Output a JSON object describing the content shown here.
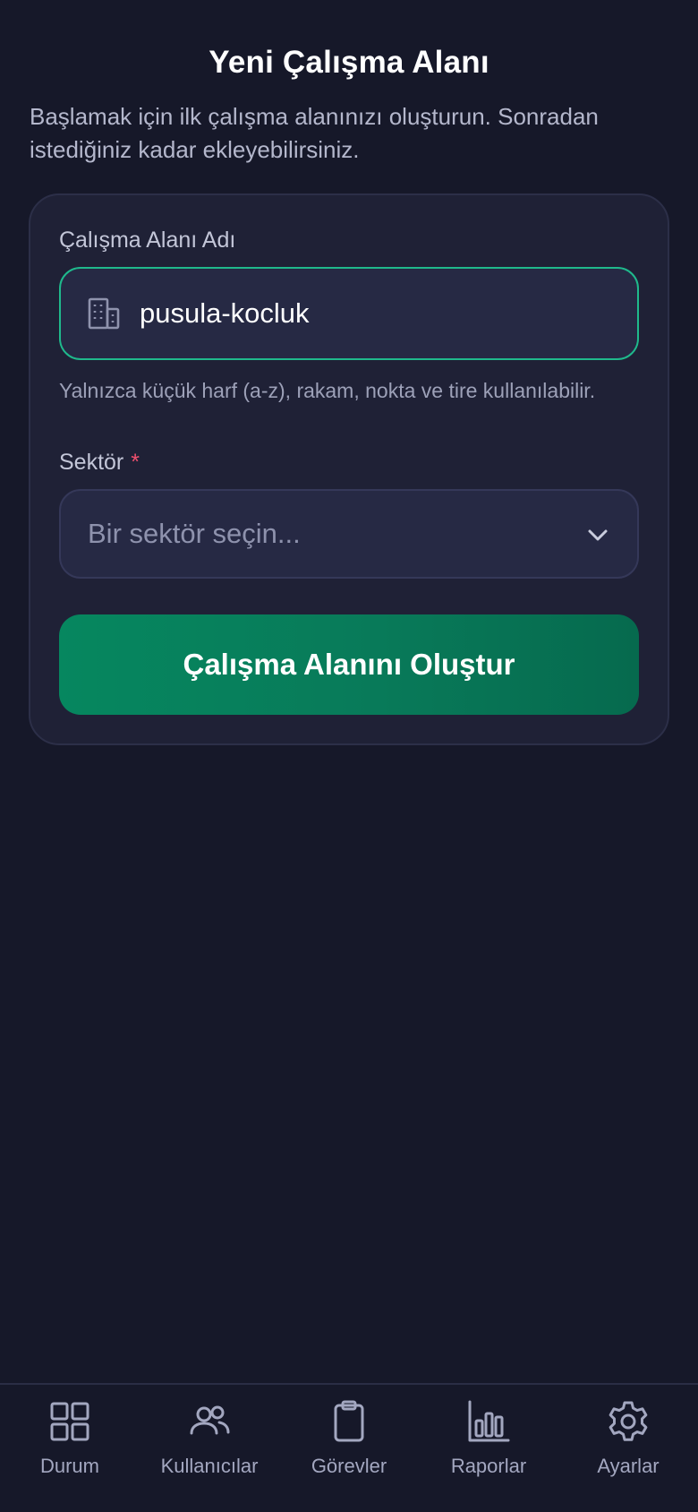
{
  "header": {
    "title": "Yeni Çalışma Alanı",
    "subtitle": "Başlamak için ilk çalışma alanınızı oluşturun. Sonradan istediğiniz kadar ekleyebilirsiniz."
  },
  "form": {
    "workspace_label": "Çalışma Alanı Adı",
    "workspace_value": "pusula-kocluk",
    "workspace_icon": "building-icon",
    "workspace_hint": "Yalnızca küçük harf (a-z), rakam, nokta ve tire kullanılabilir.",
    "sector_label": "Sektör",
    "sector_required_mark": "*",
    "sector_placeholder": "Bir sektör seçin...",
    "submit_label": "Çalışma Alanını Oluştur"
  },
  "tabbar": {
    "items": [
      {
        "label": "Durum",
        "icon": "grid-icon"
      },
      {
        "label": "Kullanıcılar",
        "icon": "users-icon"
      },
      {
        "label": "Görevler",
        "icon": "clipboard-icon"
      },
      {
        "label": "Raporlar",
        "icon": "bar-chart-icon"
      },
      {
        "label": "Ayarlar",
        "icon": "gear-icon"
      }
    ]
  },
  "colors": {
    "background": "#161829",
    "card": "#1f2136",
    "accent": "#1fb98c",
    "button": "#087a59",
    "required": "#f0506e"
  }
}
